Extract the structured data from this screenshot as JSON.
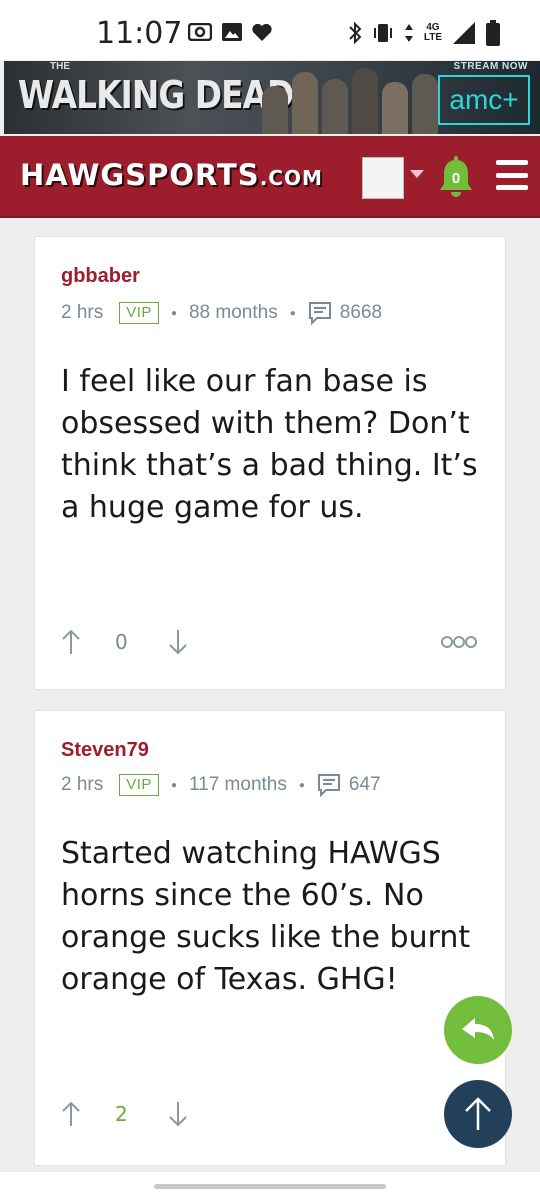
{
  "status_bar": {
    "time": "11:07",
    "network_label": "4G",
    "network_sub": "LTE",
    "icons": [
      "screencast-icon",
      "image-icon",
      "heart-icon",
      "bluetooth-icon",
      "vibrate-icon",
      "data-arrows-icon",
      "signal-icon",
      "battery-icon"
    ]
  },
  "ad": {
    "brand_small": "THE",
    "title": "WALKING DEAD",
    "cta": "STREAM NOW",
    "network": "amc+"
  },
  "header": {
    "logo_main": "HAWGSPORTS",
    "logo_suffix": ".COM",
    "notification_count": "0",
    "accent": "#9c1d2c"
  },
  "posts": [
    {
      "username": "gbbaber",
      "time": "2 hrs",
      "badge": "VIP",
      "tenure": "88 months",
      "post_count": "8668",
      "body": "I feel like our fan base is obsessed with them? Don’t think that’s a bad thing. It’s a huge game for us.",
      "score": "0"
    },
    {
      "username": "Steven79",
      "time": "2 hrs",
      "badge": "VIP",
      "tenure": "117 months",
      "post_count": "647",
      "body": "Started watching HAWGS horns since the 60’s. No orange sucks like the burnt orange of Texas. GHG!",
      "score": "2"
    }
  ],
  "colors": {
    "vip_green": "#6da93f",
    "reply_fab": "#72be3c",
    "top_fab": "#23405a"
  }
}
